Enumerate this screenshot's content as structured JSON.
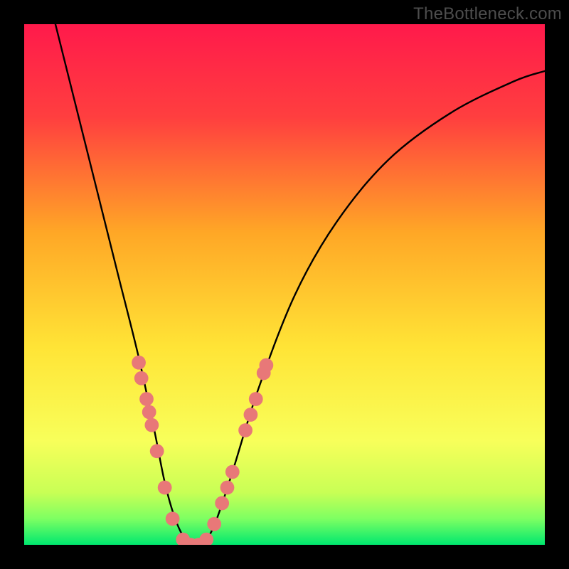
{
  "watermark": "TheBottleneck.com",
  "chart_data": {
    "type": "line",
    "title": "",
    "xlabel": "",
    "ylabel": "",
    "xlim": [
      0,
      100
    ],
    "ylim": [
      0,
      100
    ],
    "gradient_stops": [
      {
        "offset": 0,
        "color": "#ff1a4b"
      },
      {
        "offset": 18,
        "color": "#ff3f3f"
      },
      {
        "offset": 40,
        "color": "#ffa726"
      },
      {
        "offset": 62,
        "color": "#ffe436"
      },
      {
        "offset": 80,
        "color": "#f8ff5a"
      },
      {
        "offset": 90,
        "color": "#c8ff55"
      },
      {
        "offset": 95,
        "color": "#7dff62"
      },
      {
        "offset": 100,
        "color": "#00e86f"
      }
    ],
    "series": [
      {
        "name": "bottleneck-curve",
        "points": [
          {
            "x": 6,
            "y": 100
          },
          {
            "x": 10,
            "y": 84
          },
          {
            "x": 14,
            "y": 68
          },
          {
            "x": 18,
            "y": 52
          },
          {
            "x": 22,
            "y": 36
          },
          {
            "x": 25,
            "y": 22
          },
          {
            "x": 27,
            "y": 12
          },
          {
            "x": 29,
            "y": 5
          },
          {
            "x": 31,
            "y": 1
          },
          {
            "x": 33,
            "y": 0
          },
          {
            "x": 35,
            "y": 1
          },
          {
            "x": 37,
            "y": 5
          },
          {
            "x": 40,
            "y": 14
          },
          {
            "x": 45,
            "y": 30
          },
          {
            "x": 52,
            "y": 48
          },
          {
            "x": 60,
            "y": 62
          },
          {
            "x": 70,
            "y": 74
          },
          {
            "x": 82,
            "y": 83
          },
          {
            "x": 94,
            "y": 89
          },
          {
            "x": 100,
            "y": 91
          }
        ]
      }
    ],
    "markers": {
      "name": "data-points",
      "color": "#e87878",
      "radius_pct": 1.35,
      "points": [
        {
          "x": 22.0,
          "y": 35
        },
        {
          "x": 22.5,
          "y": 32
        },
        {
          "x": 23.5,
          "y": 28
        },
        {
          "x": 24.0,
          "y": 25.5
        },
        {
          "x": 24.5,
          "y": 23
        },
        {
          "x": 25.5,
          "y": 18
        },
        {
          "x": 27.0,
          "y": 11
        },
        {
          "x": 28.5,
          "y": 5
        },
        {
          "x": 30.5,
          "y": 1
        },
        {
          "x": 32.0,
          "y": 0
        },
        {
          "x": 33.5,
          "y": 0
        },
        {
          "x": 35.0,
          "y": 1
        },
        {
          "x": 36.5,
          "y": 4
        },
        {
          "x": 38.0,
          "y": 8
        },
        {
          "x": 39.0,
          "y": 11
        },
        {
          "x": 40.0,
          "y": 14
        },
        {
          "x": 42.5,
          "y": 22
        },
        {
          "x": 43.5,
          "y": 25
        },
        {
          "x": 44.5,
          "y": 28
        },
        {
          "x": 46.0,
          "y": 33
        },
        {
          "x": 46.5,
          "y": 34.5
        }
      ]
    }
  }
}
